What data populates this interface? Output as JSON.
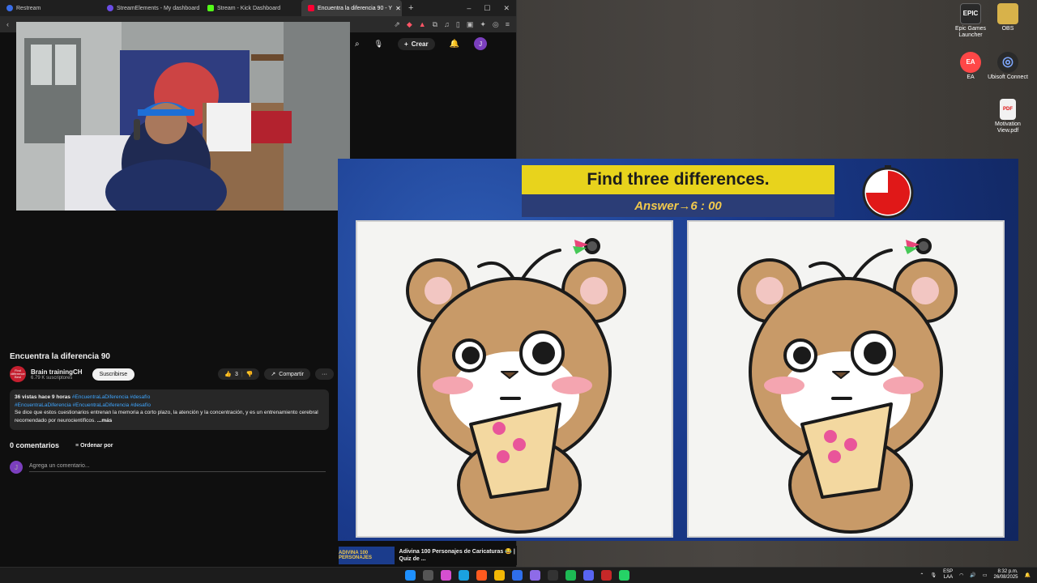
{
  "browser": {
    "tabs": [
      {
        "label": "Restream",
        "color": "#3a6ee8"
      },
      {
        "label": "StreamElements - My dashboard",
        "color": "#6b4de6"
      },
      {
        "label": "Stream - Kick Dashboard",
        "color": "#53fc18"
      },
      {
        "label": "Encuentra la diferencia 90 - Y",
        "color": "#ff0033"
      }
    ],
    "new_tab": "+",
    "win_min": "–",
    "win_max": "☐",
    "win_close": "✕"
  },
  "youtube": {
    "create_label": "Crear",
    "avatar_letter": "J",
    "video_title": "Encuentra la diferencia 90",
    "channel_name": "Brain trainingCH",
    "channel_avatar_text": "Find difference Best",
    "channel_subs": "6.79 K suscriptores",
    "subscribe_label": "Suscribirse",
    "likes": "3",
    "share_label": "Compartir",
    "more_label": "···",
    "desc_stats": "36 vistas  hace 9 horas",
    "desc_tags1": "#EncuentraLaDiferencia #desafío",
    "desc_tags2": "#EncuentraLaDiferencia #EncuentraLaDiferencia #desafío",
    "desc_text": "Se dice que estos cuestionarios entrenan la memoria a corto plazo, la atención y la concentración, y es un entrenamiento cerebral recomendado por neurocientíficos.",
    "desc_more": " ...más",
    "comments_count": "0 comentarios",
    "sort_label": "Ordenar por",
    "comment_avatar": "J",
    "comment_placeholder": "Agrega un comentario...",
    "next_thumb_label": "ADIVINA 100 PERSONAJES",
    "next_title": "Adivina 100 Personajes de Caricaturas 😂 | Quiz de ..."
  },
  "game": {
    "title": "Find three differences.",
    "answer": "Answer→6 : 00",
    "timer_remaining_fraction": 0.75
  },
  "desktop": {
    "icons": [
      {
        "label": "Epic Games Launcher",
        "text": "EPIC",
        "color": "#2a2a2a"
      },
      {
        "label": "OBS",
        "text": "",
        "color": "#d8b24a"
      },
      {
        "label": "EA",
        "text": "EA",
        "color": "#ff4747"
      },
      {
        "label": "Ubisoft Connect",
        "text": "◎",
        "color": "#2a2a2a"
      },
      {
        "label": "Motivation View.pdf",
        "text": "PDF",
        "color": "#f2f2f2"
      }
    ]
  },
  "taskbar": {
    "lang": "ESP",
    "lang2": "LAA",
    "time": "8:32 p.m.",
    "date": "26/08/2025"
  }
}
